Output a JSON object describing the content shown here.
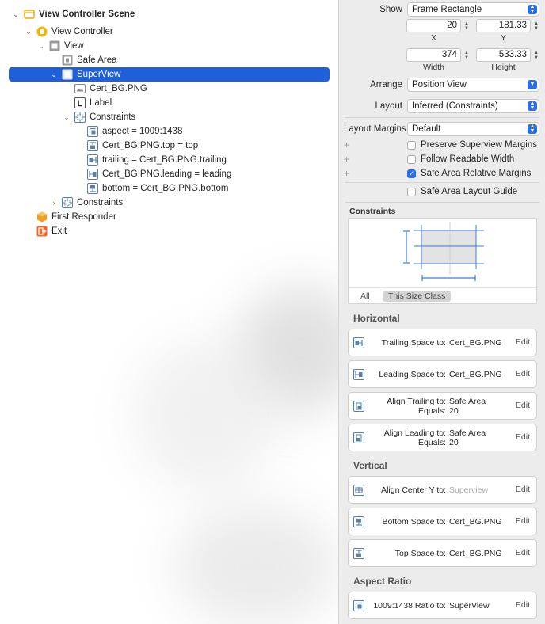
{
  "outline": {
    "items": [
      {
        "label": "View Controller Scene"
      },
      {
        "label": "View Controller"
      },
      {
        "label": "View"
      },
      {
        "label": "Safe Area"
      },
      {
        "label": "SuperView"
      },
      {
        "label": "Cert_BG.PNG"
      },
      {
        "label": "Label"
      },
      {
        "label": "Constraints"
      },
      {
        "label": "aspect = 1009:1438"
      },
      {
        "label": "Cert_BG.PNG.top = top"
      },
      {
        "label": "trailing = Cert_BG.PNG.trailing"
      },
      {
        "label": "Cert_BG.PNG.leading = leading"
      },
      {
        "label": "bottom = Cert_BG.PNG.bottom"
      },
      {
        "label": "Constraints"
      },
      {
        "label": "First Responder"
      },
      {
        "label": "Exit"
      }
    ]
  },
  "inspector": {
    "show_label": "Show",
    "show_value": "Frame Rectangle",
    "x_value": "20",
    "y_value": "181.33",
    "x_caption": "X",
    "y_caption": "Y",
    "width_value": "374",
    "height_value": "533.33",
    "width_caption": "Width",
    "height_caption": "Height",
    "arrange_label": "Arrange",
    "arrange_value": "Position View",
    "layout_label": "Layout",
    "layout_value": "Inferred (Constraints)",
    "margins_label": "Layout Margins",
    "margins_value": "Default",
    "preserve_label": "Preserve Superview Margins",
    "preserve_checked": false,
    "readable_label": "Follow Readable Width",
    "readable_checked": false,
    "safe_relative_label": "Safe Area Relative Margins",
    "safe_relative_checked": true,
    "safe_guide_label": "Safe Area Layout Guide",
    "safe_guide_checked": false,
    "constraints_title": "Constraints",
    "seg_all": "All",
    "seg_size_class": "This Size Class",
    "accent_color": "#2a6ee8",
    "selection_color": "#1f5fd9"
  },
  "sections": {
    "horizontal": "Horizontal",
    "vertical": "Vertical",
    "aspect": "Aspect Ratio"
  },
  "constraints": {
    "edit_label": "Edit",
    "horizontal": [
      {
        "icon": "trailing-space-icon",
        "line1_key": "Trailing Space to:",
        "line1_val": "Cert_BG.PNG"
      },
      {
        "icon": "leading-space-icon",
        "line1_key": "Leading Space to:",
        "line1_val": "Cert_BG.PNG"
      },
      {
        "icon": "align-trailing-icon",
        "line1_key": "Align Trailing to:",
        "line1_val": "Safe Area",
        "line2_key": "Equals:",
        "line2_val": "20"
      },
      {
        "icon": "align-leading-icon",
        "line1_key": "Align Leading to:",
        "line1_val": "Safe Area",
        "line2_key": "Equals:",
        "line2_val": "20"
      }
    ],
    "vertical": [
      {
        "icon": "align-center-y-icon",
        "line1_key": "Align Center Y to:",
        "line1_val": "Superview"
      },
      {
        "icon": "bottom-space-icon",
        "line1_key": "Bottom Space to:",
        "line1_val": "Cert_BG.PNG"
      },
      {
        "icon": "top-space-icon",
        "line1_key": "Top Space to:",
        "line1_val": "Cert_BG.PNG"
      }
    ],
    "aspect": [
      {
        "icon": "aspect-ratio-icon",
        "line1_key": "1009:1438 Ratio to:",
        "line1_val": "SuperView"
      }
    ]
  }
}
